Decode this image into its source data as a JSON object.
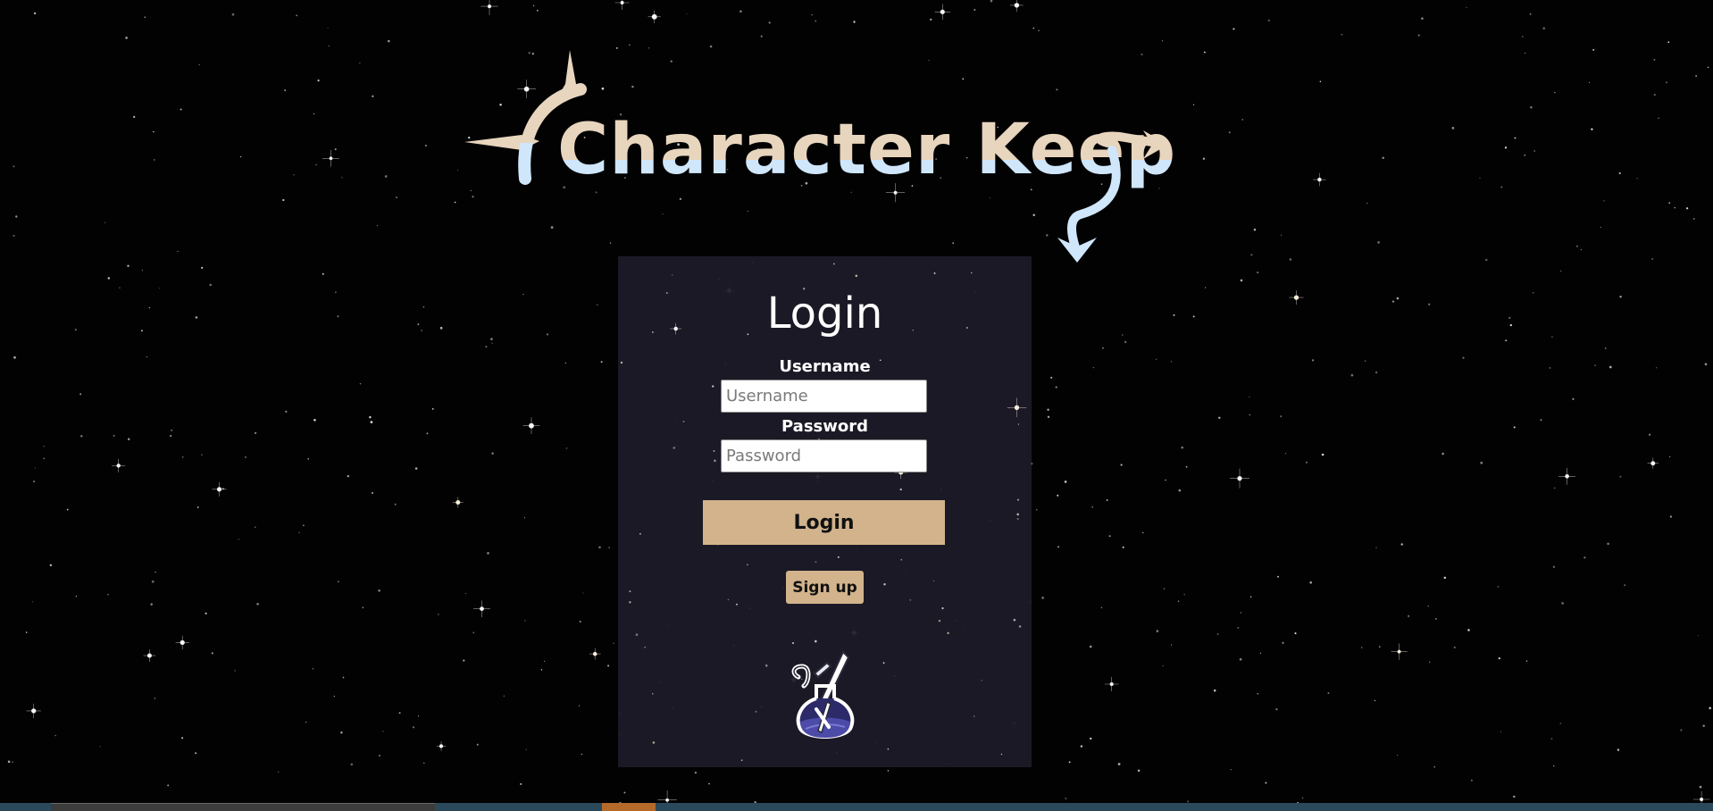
{
  "app": {
    "logo_text": "Character Keep"
  },
  "login": {
    "title": "Login",
    "username_label": "Username",
    "username_placeholder": "Username",
    "username_value": "",
    "password_label": "Password",
    "password_placeholder": "Password",
    "password_value": "",
    "login_button": "Login",
    "signup_button": "Sign up"
  },
  "icons": {
    "logo_decoration": "sparkle-arrow-ornament",
    "panel_emblem": "potion-sword-icon"
  },
  "colors": {
    "background": "#000000",
    "panel": "#1e1b28",
    "accent": "#d2b38c",
    "logo_cream": "#e8d5bd",
    "logo_blue": "#cfe6fb",
    "potion_purple": "#4c4ba8",
    "text": "#ffffff"
  }
}
